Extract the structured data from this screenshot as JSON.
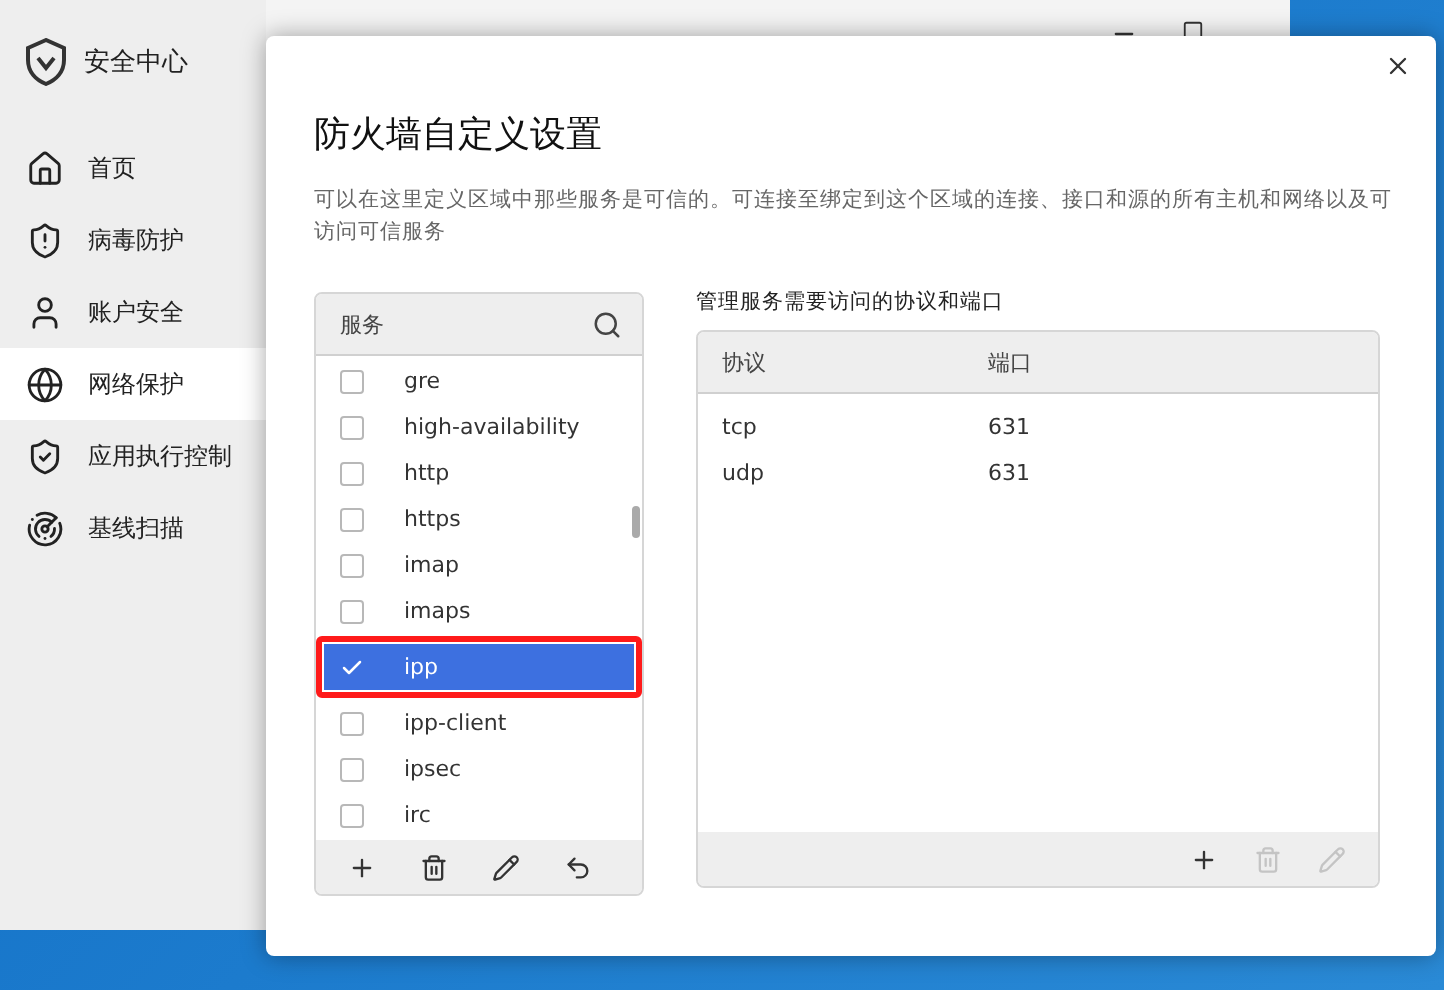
{
  "app": {
    "title": "安全中心"
  },
  "sidebar": {
    "items": [
      {
        "label": "首页",
        "selected": false
      },
      {
        "label": "病毒防护",
        "selected": false
      },
      {
        "label": "账户安全",
        "selected": false
      },
      {
        "label": "网络保护",
        "selected": true
      },
      {
        "label": "应用执行控制",
        "selected": false
      },
      {
        "label": "基线扫描",
        "selected": false
      }
    ]
  },
  "dialog": {
    "title": "防火墙自定义设置",
    "description": "可以在这里定义区域中那些服务是可信的。可连接至绑定到这个区域的连接、接口和源的所有主机和网络以及可访问可信服务",
    "services": {
      "header": "服务",
      "items": [
        {
          "label": "gre",
          "checked": false,
          "selected": false
        },
        {
          "label": "high-availability",
          "checked": false,
          "selected": false
        },
        {
          "label": "http",
          "checked": false,
          "selected": false
        },
        {
          "label": "https",
          "checked": false,
          "selected": false
        },
        {
          "label": "imap",
          "checked": false,
          "selected": false
        },
        {
          "label": "imaps",
          "checked": false,
          "selected": false
        },
        {
          "label": "ipp",
          "checked": true,
          "selected": true
        },
        {
          "label": "ipp-client",
          "checked": false,
          "selected": false
        },
        {
          "label": "ipsec",
          "checked": false,
          "selected": false
        },
        {
          "label": "irc",
          "checked": false,
          "selected": false
        }
      ]
    },
    "ports": {
      "label": "管理服务需要访问的协议和端口",
      "columns": [
        "协议",
        "端口"
      ],
      "rows": [
        [
          "tcp",
          "631"
        ],
        [
          "udp",
          "631"
        ]
      ],
      "actions": [
        {
          "disabled": false
        },
        {
          "disabled": true
        },
        {
          "disabled": true
        }
      ]
    }
  }
}
